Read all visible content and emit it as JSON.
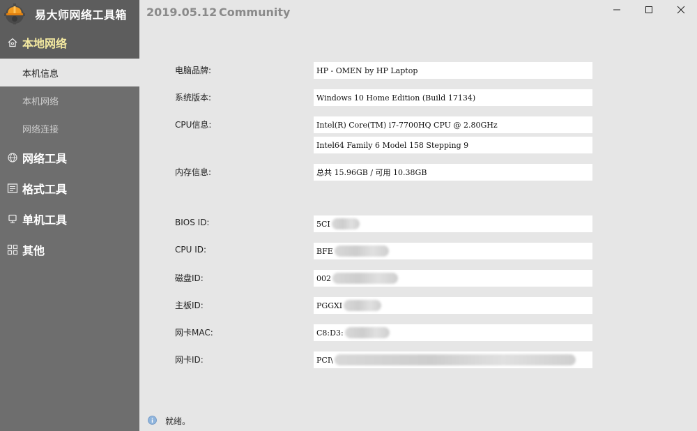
{
  "app": {
    "title": "易大师网络工具箱",
    "date": "2019.05.12",
    "edition": "Community"
  },
  "sidebar": {
    "groups": [
      {
        "label": "本地网络",
        "icon": "home-icon",
        "active": true
      },
      {
        "label": "网络工具",
        "icon": "globe-icon"
      },
      {
        "label": "格式工具",
        "icon": "document-icon"
      },
      {
        "label": "单机工具",
        "icon": "monitor-icon"
      },
      {
        "label": "其他",
        "icon": "grid-icon"
      }
    ],
    "subitems": [
      {
        "label": "本机信息",
        "selected": true
      },
      {
        "label": "本机网络"
      },
      {
        "label": "网络连接"
      }
    ]
  },
  "info": {
    "brand_label": "电脑品牌:",
    "brand_value": "HP - OMEN by HP Laptop",
    "os_label": "系统版本:",
    "os_value": "Windows 10 Home Edition (Build 17134)",
    "cpu_label": "CPU信息:",
    "cpu_value_1": "Intel(R) Core(TM) i7-7700HQ CPU @ 2.80GHz",
    "cpu_value_2": "Intel64 Family 6 Model 158 Stepping 9",
    "mem_label": "内存信息:",
    "mem_value": "总共 15.96GB / 可用 10.38GB",
    "bios_label": "BIOS ID:",
    "bios_value": "5CI",
    "cpuid_label": "CPU ID:",
    "cpuid_value": "BFE",
    "disk_label": "磁盘ID:",
    "disk_value": "002",
    "board_label": "主板ID:",
    "board_value": "PGGXI",
    "mac_label": "网卡MAC:",
    "mac_value": "C8:D3:",
    "nic_label": "网卡ID:",
    "nic_value": "PCI\\"
  },
  "status": {
    "text": "就绪。",
    "icon": "info-icon"
  },
  "colors": {
    "sidebar_bg": "#6e6e6e",
    "sidebar_active_bg": "#5d5d5d",
    "active_text": "#f4e9a0",
    "content_bg": "#e6e6e6"
  }
}
